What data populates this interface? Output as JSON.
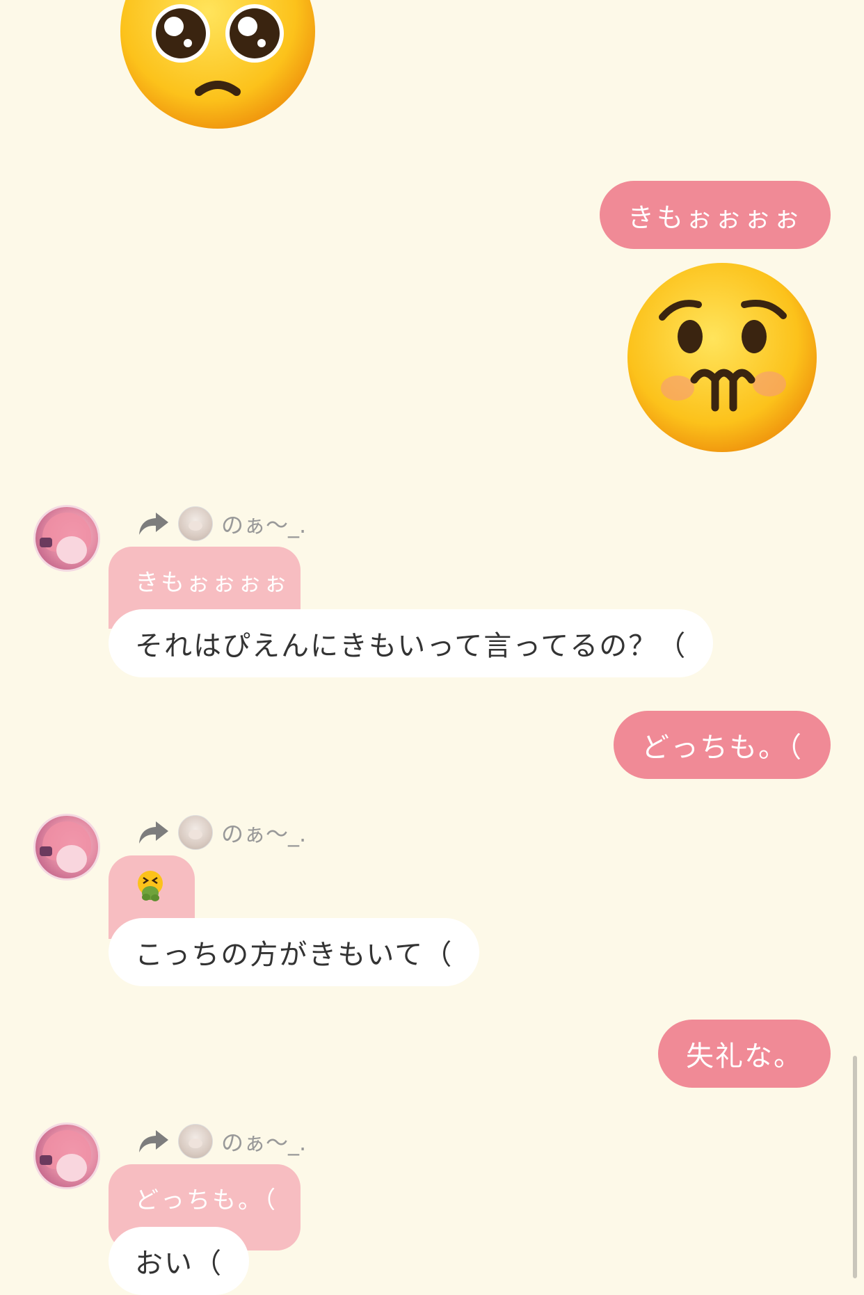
{
  "messages": {
    "m1_text": "きもぉぉぉぉ",
    "m2_forward_name": "のぁ～_.",
    "m2_quote": "きもぉぉぉぉ",
    "m2_text": "それはぴえんにきもいって言ってるの？（",
    "m3_text": "どっちも。（",
    "m4_forward_name": "のぁ～_.",
    "m4_text": "こっちの方がきもいて（",
    "m5_text": "失礼な。",
    "m6_forward_name": "のぁ～_.",
    "m6_quote": "どっちも。（",
    "m6_text": "おい（"
  },
  "icons": {
    "pleading_emoji": "pleading-face-emoji",
    "nauseated_emoji": "nauseated-face-emoji",
    "vomit_emoji": "vomiting-face-emoji",
    "forward": "forward-arrow-icon"
  },
  "colors": {
    "background": "#fdf9e8",
    "outgoing_bubble": "#f08a96",
    "incoming_bubble": "#ffffff",
    "quote_bubble": "#f7bdc1"
  }
}
